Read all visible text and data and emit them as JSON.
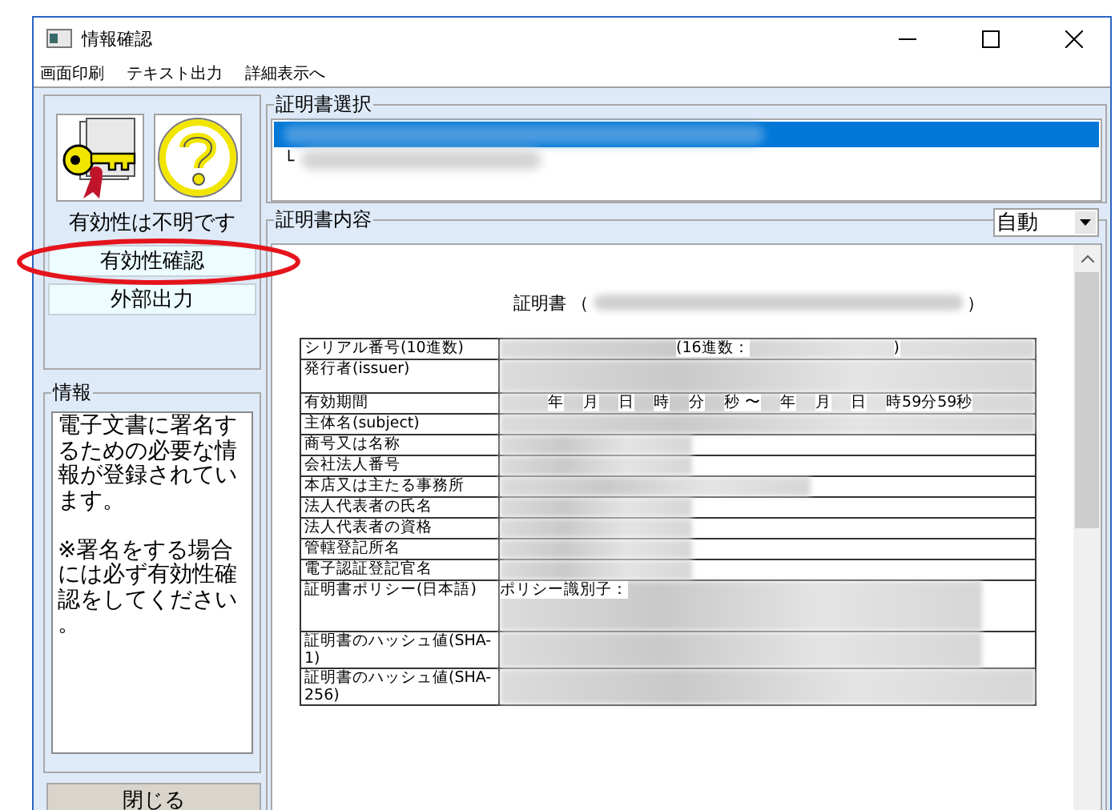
{
  "window": {
    "title": "情報確認"
  },
  "menu": [
    "画面印刷",
    "テキスト出力",
    "詳細表示へ"
  ],
  "status": {
    "label": "有効性は不明です"
  },
  "actions": [
    {
      "label": "有効性確認",
      "highlighted": true
    },
    {
      "label": "外部出力",
      "highlighted": false
    }
  ],
  "info": {
    "title": "情報",
    "paragraphs": [
      "電子文書に署名するための必要な情報が登録されています。",
      "※署名をする場合には必ず有効性確認をしてください。"
    ]
  },
  "close_button": "閉じる",
  "certificate_select": {
    "title": "証明書選択",
    "items": [
      {
        "selected": true
      },
      {
        "prefix": "└",
        "selected": false
      }
    ]
  },
  "certificate_content": {
    "title": "証明書内容",
    "mode": "自動",
    "heading": "証明書",
    "heading_open": "（",
    "heading_close": "）",
    "rows": [
      {
        "label": "シリアル番号(10進数)",
        "kind": "short",
        "value_texts": [
          "(16進数：",
          ")"
        ]
      },
      {
        "label": "発行者(issuer)",
        "kind": "tall",
        "value_texts": []
      },
      {
        "label": "有効期間",
        "kind": "short",
        "value_texts": [
          "年",
          "月",
          "日",
          "時",
          "分",
          "秒 〜",
          "年",
          "月",
          "日",
          "時59分59秒"
        ]
      },
      {
        "label": "主体名(subject)",
        "kind": "short",
        "value_texts": []
      },
      {
        "label": "商号又は名称",
        "kind": "short",
        "value_texts": []
      },
      {
        "label": "会社法人番号",
        "kind": "short",
        "value_texts": []
      },
      {
        "label": "本店又は主たる事務所",
        "kind": "short",
        "value_texts": []
      },
      {
        "label": "法人代表者の氏名",
        "kind": "short",
        "value_texts": []
      },
      {
        "label": "法人代表者の資格",
        "kind": "short",
        "value_texts": []
      },
      {
        "label": "管轄登記所名",
        "kind": "short",
        "value_texts": []
      },
      {
        "label": "電子認証登記官名",
        "kind": "short",
        "value_texts": []
      },
      {
        "label": "証明書ポリシー(日本語)",
        "kind": "tall",
        "value_texts": [
          "ポリシー識別子："
        ]
      },
      {
        "label": "証明書のハッシュ値(SHA-1)",
        "kind": "medium",
        "value_texts": []
      },
      {
        "label": "証明書のハッシュ値(SHA-256)",
        "kind": "medium",
        "value_texts": []
      }
    ]
  }
}
